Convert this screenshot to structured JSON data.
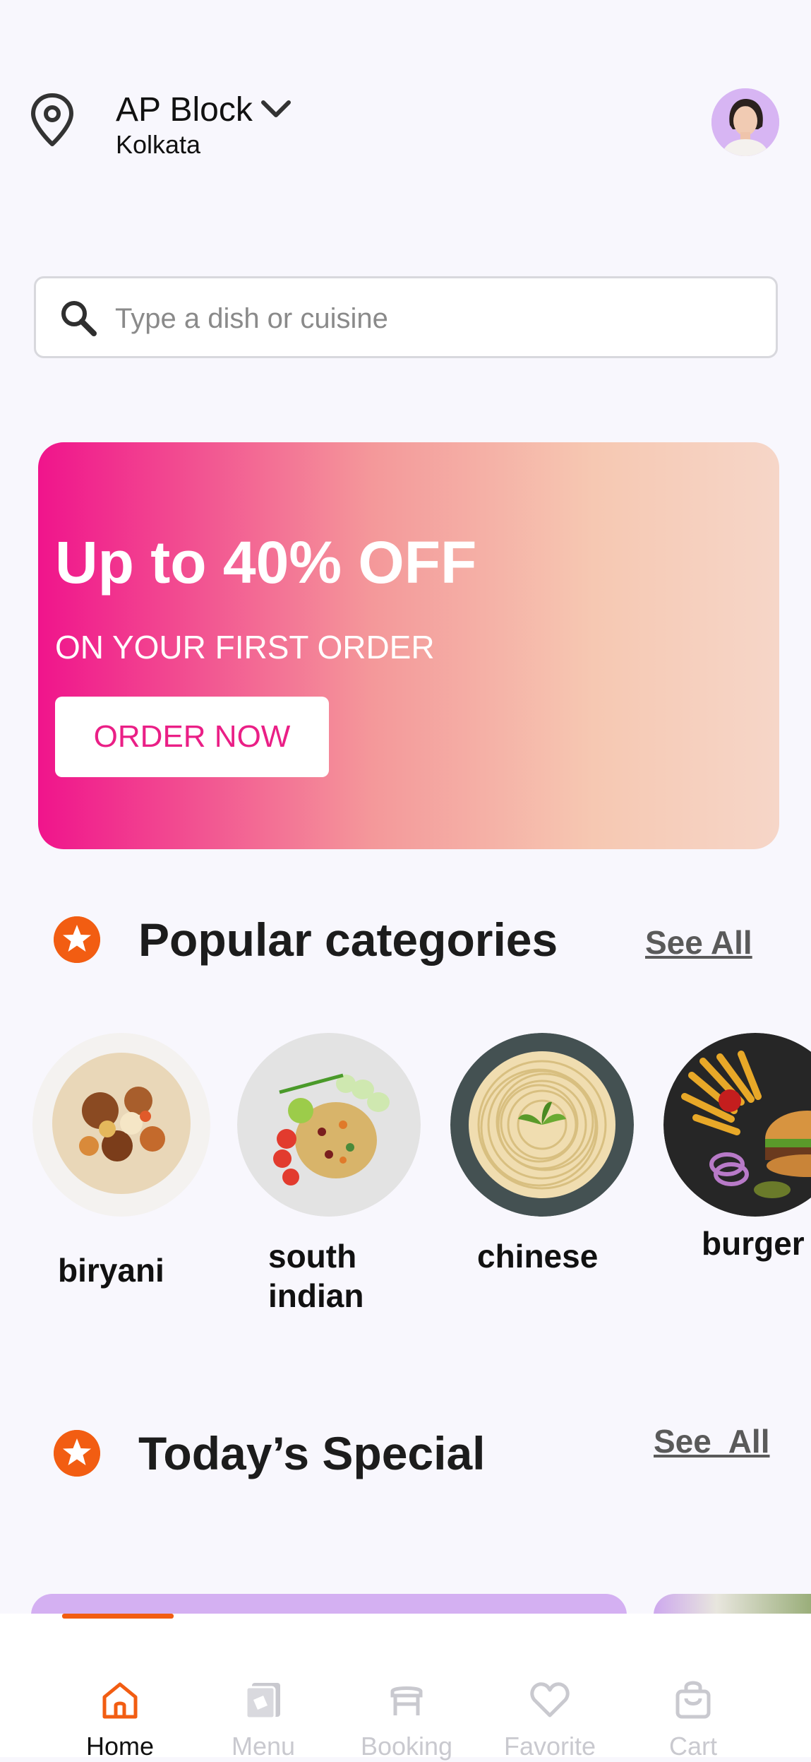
{
  "header": {
    "location_icon": "map-pin-icon",
    "location_title": "AP Block",
    "dropdown_icon": "chevron-down-icon",
    "city": "Kolkata",
    "avatar_icon": "user-avatar"
  },
  "search": {
    "icon": "search-icon",
    "placeholder": "Type a dish or cuisine"
  },
  "banner": {
    "title": "Up to 40% OFF",
    "subtitle": "ON YOUR FIRST ORDER",
    "button_label": "ORDER NOW",
    "gradient_start": "#f0148c",
    "gradient_end": "#f6d6c8"
  },
  "popular": {
    "icon": "star-badge-icon",
    "title": "Popular categories",
    "see_all": "See All",
    "items": [
      {
        "line1": "biryani",
        "line2": "",
        "image": "biryani-image"
      },
      {
        "line1": "south",
        "line2": "indian",
        "image": "south-indian-image"
      },
      {
        "line1": "chinese",
        "line2": "",
        "image": "chinese-noodles-image"
      },
      {
        "line1": "burger",
        "line2": "",
        "image": "burger-image"
      }
    ]
  },
  "special": {
    "icon": "star-badge-icon",
    "title": "Today’s Special",
    "see_all": "See  All"
  },
  "nav": {
    "active_color": "#f25d12",
    "inactive_color": "#c9c9cf",
    "items": [
      {
        "label": "Home",
        "icon": "home-icon",
        "active": true
      },
      {
        "label": "Menu",
        "icon": "menu-book-icon",
        "active": false
      },
      {
        "label": "Booking",
        "icon": "table-icon",
        "active": false
      },
      {
        "label": "Favorite",
        "icon": "heart-icon",
        "active": false
      },
      {
        "label": "Cart",
        "icon": "shopping-bag-icon",
        "active": false
      }
    ]
  }
}
